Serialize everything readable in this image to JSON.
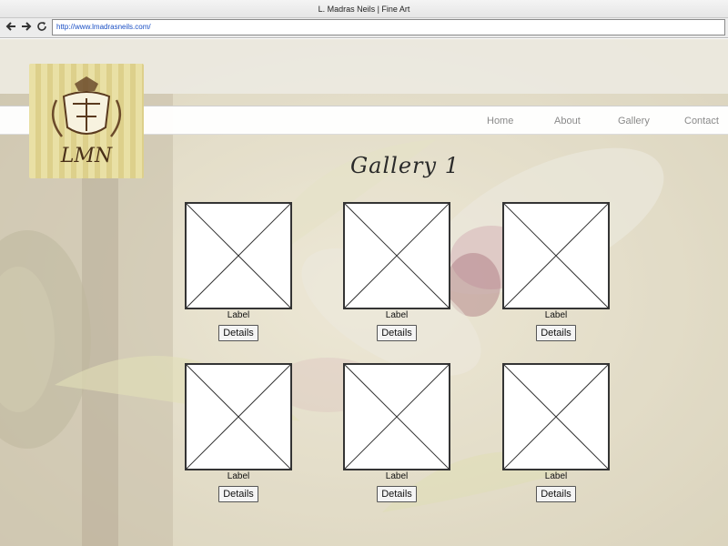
{
  "browser": {
    "window_title": "L. Madras Neils | Fine Art",
    "url": "http://www.lmadrasneils.com/",
    "back_icon": "arrow-left-icon",
    "forward_icon": "arrow-right-icon",
    "reload_icon": "reload-icon"
  },
  "site": {
    "logo_text": "LMN",
    "nav": [
      {
        "label": "Home"
      },
      {
        "label": "About"
      },
      {
        "label": "Gallery"
      },
      {
        "label": "Contact"
      }
    ],
    "heading": "Gallery 1",
    "items": [
      {
        "label": "Label",
        "button": "Details"
      },
      {
        "label": "Label",
        "button": "Details"
      },
      {
        "label": "Label",
        "button": "Details"
      },
      {
        "label": "Label",
        "button": "Details"
      },
      {
        "label": "Label",
        "button": "Details"
      },
      {
        "label": "Label",
        "button": "Details"
      }
    ]
  },
  "colors": {
    "url_text": "#1a4fc4",
    "nav_text": "#8a8a8a",
    "logo_stripes": "#e9e0a5"
  }
}
